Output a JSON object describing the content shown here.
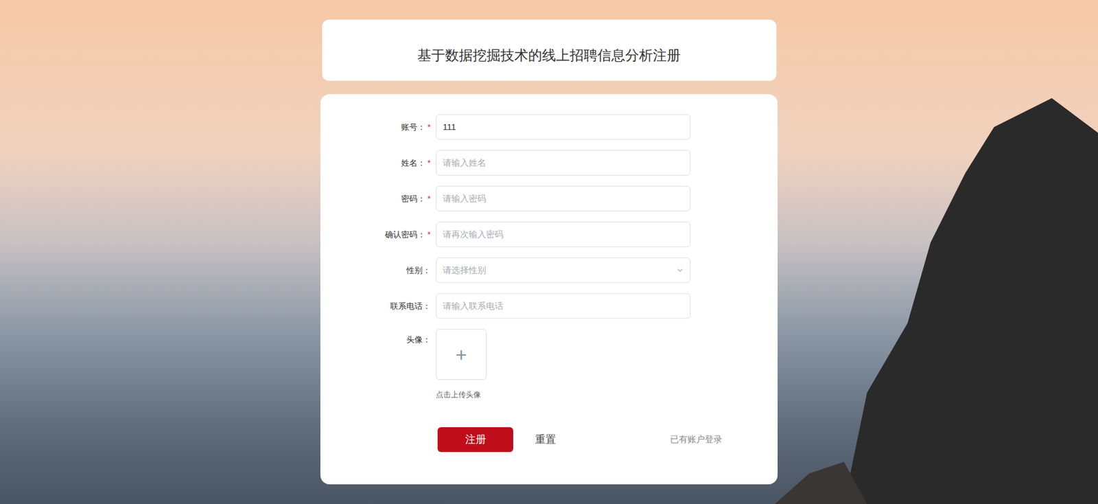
{
  "page": {
    "title": "基于数据挖掘技术的线上招聘信息分析注册"
  },
  "form": {
    "fields": [
      {
        "label": "账号：",
        "required": true,
        "kind": "text",
        "value": "111",
        "placeholder": ""
      },
      {
        "label": "姓名：",
        "required": true,
        "kind": "text",
        "value": "",
        "placeholder": "请输入姓名"
      },
      {
        "label": "密码：",
        "required": true,
        "kind": "text",
        "value": "",
        "placeholder": "请输入密码"
      },
      {
        "label": "确认密码：",
        "required": true,
        "kind": "text",
        "value": "",
        "placeholder": "请再次输入密码"
      },
      {
        "label": "性别：",
        "required": false,
        "kind": "select",
        "value": "",
        "placeholder": "请选择性别"
      },
      {
        "label": "联系电话：",
        "required": false,
        "kind": "text",
        "value": "",
        "placeholder": "请输入联系电话"
      }
    ],
    "required_mark": "*",
    "avatar": {
      "label": "头像：",
      "icon": "+",
      "hint": "点击上传头像"
    }
  },
  "buttons": {
    "submit": "注册",
    "reset": "重置"
  },
  "login_link": "已有账户登录"
}
